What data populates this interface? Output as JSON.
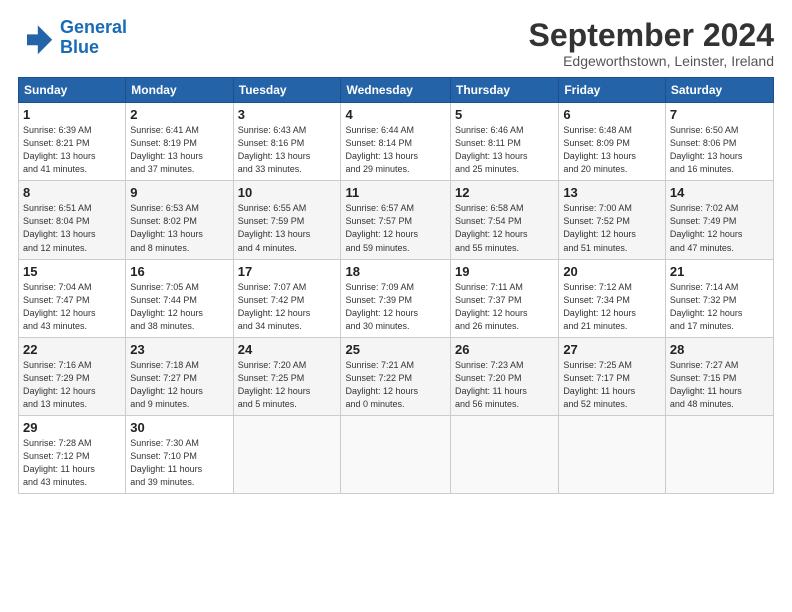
{
  "header": {
    "logo_line1": "General",
    "logo_line2": "Blue",
    "title": "September 2024",
    "subtitle": "Edgeworthstown, Leinster, Ireland"
  },
  "days_of_week": [
    "Sunday",
    "Monday",
    "Tuesday",
    "Wednesday",
    "Thursday",
    "Friday",
    "Saturday"
  ],
  "weeks": [
    [
      {
        "day": "1",
        "info": "Sunrise: 6:39 AM\nSunset: 8:21 PM\nDaylight: 13 hours\nand 41 minutes."
      },
      {
        "day": "2",
        "info": "Sunrise: 6:41 AM\nSunset: 8:19 PM\nDaylight: 13 hours\nand 37 minutes."
      },
      {
        "day": "3",
        "info": "Sunrise: 6:43 AM\nSunset: 8:16 PM\nDaylight: 13 hours\nand 33 minutes."
      },
      {
        "day": "4",
        "info": "Sunrise: 6:44 AM\nSunset: 8:14 PM\nDaylight: 13 hours\nand 29 minutes."
      },
      {
        "day": "5",
        "info": "Sunrise: 6:46 AM\nSunset: 8:11 PM\nDaylight: 13 hours\nand 25 minutes."
      },
      {
        "day": "6",
        "info": "Sunrise: 6:48 AM\nSunset: 8:09 PM\nDaylight: 13 hours\nand 20 minutes."
      },
      {
        "day": "7",
        "info": "Sunrise: 6:50 AM\nSunset: 8:06 PM\nDaylight: 13 hours\nand 16 minutes."
      }
    ],
    [
      {
        "day": "8",
        "info": "Sunrise: 6:51 AM\nSunset: 8:04 PM\nDaylight: 13 hours\nand 12 minutes."
      },
      {
        "day": "9",
        "info": "Sunrise: 6:53 AM\nSunset: 8:02 PM\nDaylight: 13 hours\nand 8 minutes."
      },
      {
        "day": "10",
        "info": "Sunrise: 6:55 AM\nSunset: 7:59 PM\nDaylight: 13 hours\nand 4 minutes."
      },
      {
        "day": "11",
        "info": "Sunrise: 6:57 AM\nSunset: 7:57 PM\nDaylight: 12 hours\nand 59 minutes."
      },
      {
        "day": "12",
        "info": "Sunrise: 6:58 AM\nSunset: 7:54 PM\nDaylight: 12 hours\nand 55 minutes."
      },
      {
        "day": "13",
        "info": "Sunrise: 7:00 AM\nSunset: 7:52 PM\nDaylight: 12 hours\nand 51 minutes."
      },
      {
        "day": "14",
        "info": "Sunrise: 7:02 AM\nSunset: 7:49 PM\nDaylight: 12 hours\nand 47 minutes."
      }
    ],
    [
      {
        "day": "15",
        "info": "Sunrise: 7:04 AM\nSunset: 7:47 PM\nDaylight: 12 hours\nand 43 minutes."
      },
      {
        "day": "16",
        "info": "Sunrise: 7:05 AM\nSunset: 7:44 PM\nDaylight: 12 hours\nand 38 minutes."
      },
      {
        "day": "17",
        "info": "Sunrise: 7:07 AM\nSunset: 7:42 PM\nDaylight: 12 hours\nand 34 minutes."
      },
      {
        "day": "18",
        "info": "Sunrise: 7:09 AM\nSunset: 7:39 PM\nDaylight: 12 hours\nand 30 minutes."
      },
      {
        "day": "19",
        "info": "Sunrise: 7:11 AM\nSunset: 7:37 PM\nDaylight: 12 hours\nand 26 minutes."
      },
      {
        "day": "20",
        "info": "Sunrise: 7:12 AM\nSunset: 7:34 PM\nDaylight: 12 hours\nand 21 minutes."
      },
      {
        "day": "21",
        "info": "Sunrise: 7:14 AM\nSunset: 7:32 PM\nDaylight: 12 hours\nand 17 minutes."
      }
    ],
    [
      {
        "day": "22",
        "info": "Sunrise: 7:16 AM\nSunset: 7:29 PM\nDaylight: 12 hours\nand 13 minutes."
      },
      {
        "day": "23",
        "info": "Sunrise: 7:18 AM\nSunset: 7:27 PM\nDaylight: 12 hours\nand 9 minutes."
      },
      {
        "day": "24",
        "info": "Sunrise: 7:20 AM\nSunset: 7:25 PM\nDaylight: 12 hours\nand 5 minutes."
      },
      {
        "day": "25",
        "info": "Sunrise: 7:21 AM\nSunset: 7:22 PM\nDaylight: 12 hours\nand 0 minutes."
      },
      {
        "day": "26",
        "info": "Sunrise: 7:23 AM\nSunset: 7:20 PM\nDaylight: 11 hours\nand 56 minutes."
      },
      {
        "day": "27",
        "info": "Sunrise: 7:25 AM\nSunset: 7:17 PM\nDaylight: 11 hours\nand 52 minutes."
      },
      {
        "day": "28",
        "info": "Sunrise: 7:27 AM\nSunset: 7:15 PM\nDaylight: 11 hours\nand 48 minutes."
      }
    ],
    [
      {
        "day": "29",
        "info": "Sunrise: 7:28 AM\nSunset: 7:12 PM\nDaylight: 11 hours\nand 43 minutes."
      },
      {
        "day": "30",
        "info": "Sunrise: 7:30 AM\nSunset: 7:10 PM\nDaylight: 11 hours\nand 39 minutes."
      },
      {
        "day": "",
        "info": ""
      },
      {
        "day": "",
        "info": ""
      },
      {
        "day": "",
        "info": ""
      },
      {
        "day": "",
        "info": ""
      },
      {
        "day": "",
        "info": ""
      }
    ]
  ]
}
